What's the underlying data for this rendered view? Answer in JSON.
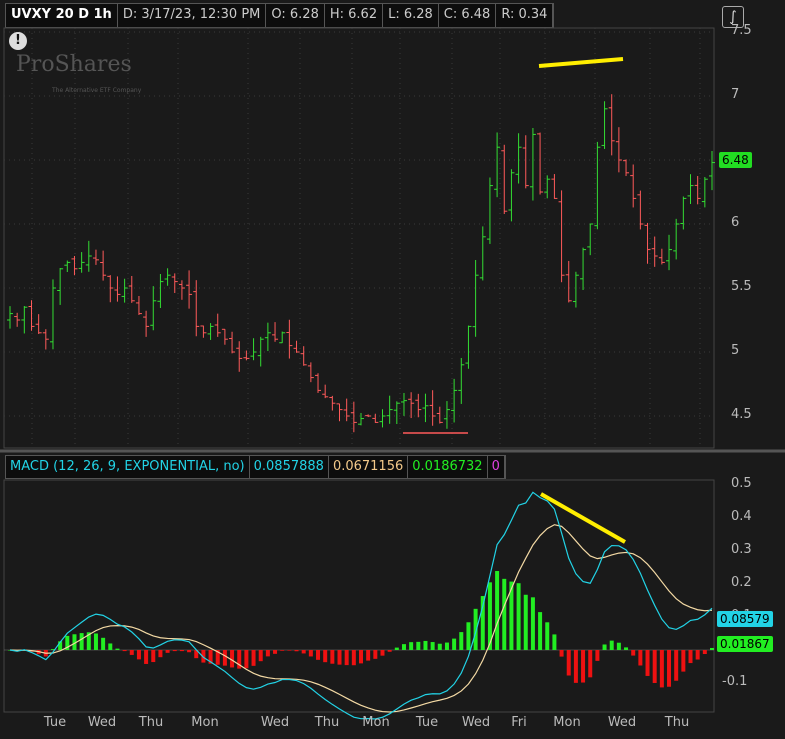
{
  "header": {
    "symbol": "UVXY 20 D 1h",
    "date": "D: 3/17/23, 12:30 PM",
    "open": "O: 6.28",
    "high": "H: 6.62",
    "low": "L: 6.28",
    "close": "C: 6.48",
    "range": "R: 0.34"
  },
  "watermark": {
    "brand": "ProShares",
    "tagline": "The Alternative ETF Company"
  },
  "colors": {
    "up": "#33dd33",
    "down": "#ff5a5a",
    "macd": "#22d3e6",
    "signal": "#f3d9a4",
    "hist_up": "#22ee22",
    "hist_down": "#ee1111",
    "annotation": "#ffee00"
  },
  "chart_data": [
    {
      "type": "ohlc",
      "title": "UVXY 20 D 1h",
      "ylim": [
        4.3,
        7.55
      ],
      "yticks": [
        "7.5",
        "7",
        "6.5",
        "6",
        "5.5",
        "5",
        "4.5"
      ],
      "last_price": "6.48",
      "closes": [
        5.3,
        5.25,
        5.35,
        5.2,
        5.15,
        5.1,
        5.5,
        5.65,
        5.7,
        5.65,
        5.7,
        5.75,
        5.72,
        5.6,
        5.5,
        5.45,
        5.5,
        5.4,
        5.3,
        5.2,
        5.4,
        5.55,
        5.6,
        5.55,
        5.5,
        5.45,
        5.2,
        5.15,
        5.2,
        5.15,
        5.1,
        5.0,
        4.95,
        4.95,
        5.0,
        5.1,
        5.15,
        5.1,
        5.15,
        5.05,
        5.0,
        4.9,
        4.8,
        4.7,
        4.65,
        4.6,
        4.55,
        4.5,
        4.45,
        4.48,
        4.5,
        4.45,
        4.5,
        4.55,
        4.6,
        4.62,
        4.6,
        4.55,
        4.58,
        4.5,
        4.45,
        4.55,
        4.7,
        4.9,
        5.2,
        5.6,
        5.9,
        6.3,
        6.6,
        6.1,
        6.4,
        6.6,
        6.3,
        6.7,
        6.25,
        6.35,
        6.2,
        5.6,
        5.4,
        5.6,
        5.8,
        6.0,
        6.6,
        6.9,
        6.65,
        6.5,
        6.4,
        6.2,
        6.0,
        5.8,
        5.75,
        5.7,
        5.8,
        6.0,
        6.2,
        6.3,
        6.2,
        6.35,
        6.48
      ]
    },
    {
      "type": "macd",
      "title": "MACD (12, 26, 9, EXPONENTIAL, no)",
      "values": {
        "macd": "0.0857888",
        "signal": "0.0671156",
        "diff": "0.0186732",
        "zero": "0"
      },
      "ylim": [
        -0.18,
        0.52
      ],
      "yticks": [
        "0.5",
        "0.4",
        "0.3",
        "0.2",
        "0.1",
        "0",
        "-0.1"
      ],
      "tags": {
        "macd": "0.08579",
        "diff": "0.01867"
      }
    }
  ],
  "x_axis": [
    "Tue",
    "Wed",
    "Thu",
    "Mon",
    "Wed",
    "Thu",
    "Mon",
    "Tue",
    "Wed",
    "Fri",
    "Mon",
    "Wed",
    "Thu"
  ]
}
